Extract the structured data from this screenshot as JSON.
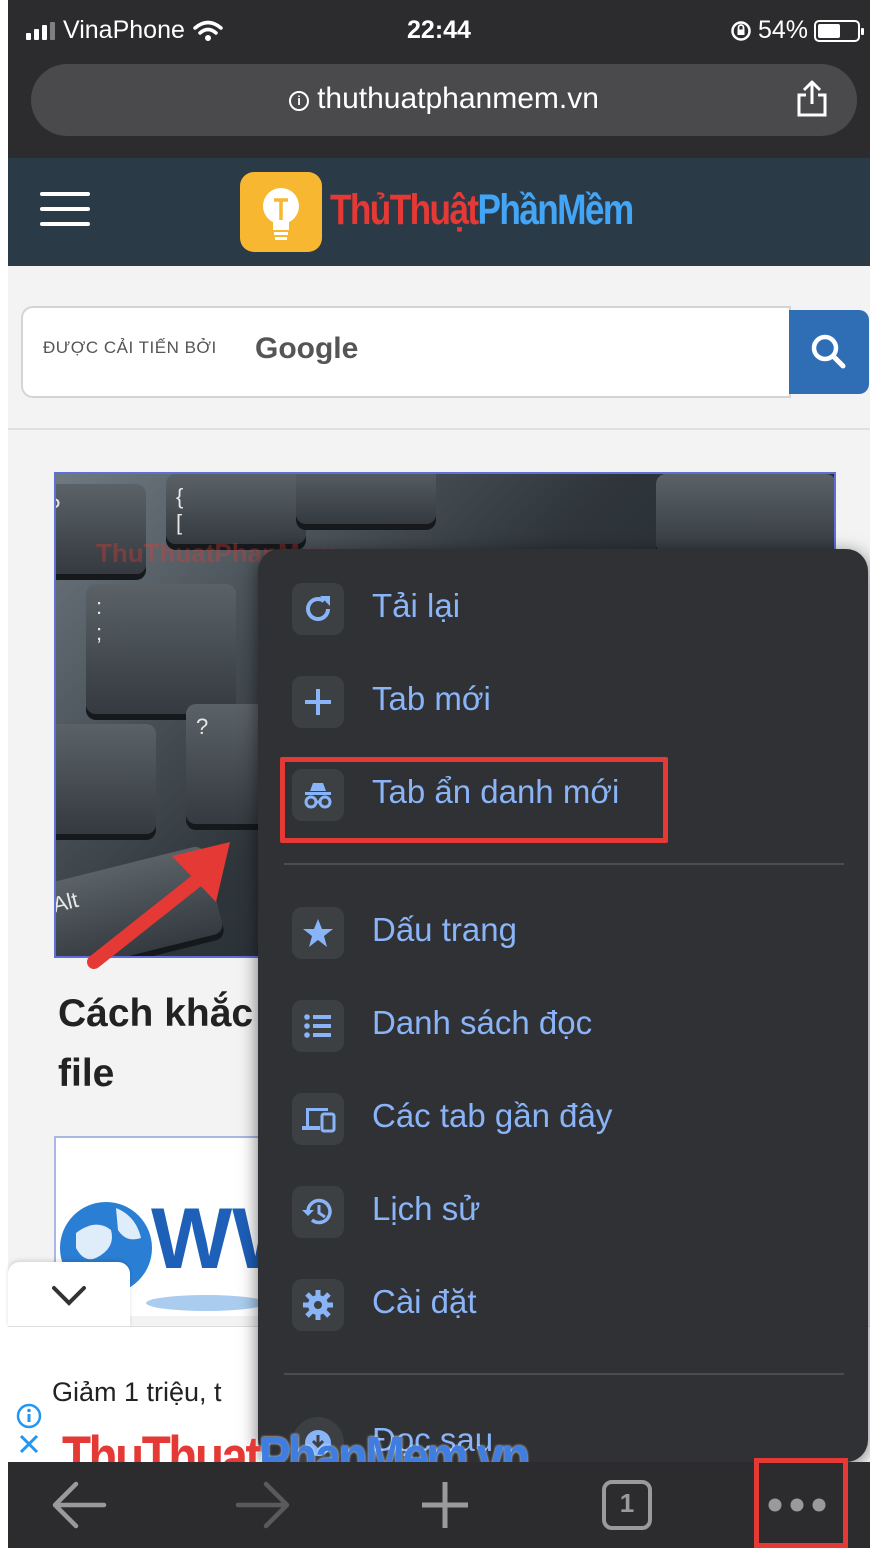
{
  "status_bar": {
    "carrier": "VinaPhone",
    "time": "22:44",
    "battery": "54%"
  },
  "address_bar": {
    "url": "thuthuatphanmem.vn"
  },
  "site": {
    "logo_part1": "ThủThuật",
    "logo_part2": "PhầnMềm",
    "search_powered": "ĐƯỢC CẢI TIẾN BỞI",
    "search_brand": "Google"
  },
  "article": {
    "title_line1": "Cách khắc",
    "title_line2": "file",
    "image_watermark": "ThuThuatPhanMem"
  },
  "ad": {
    "text": "Giảm 1 triệu, t"
  },
  "menu": {
    "items": [
      {
        "label": "Tải lại",
        "icon": "reload-icon"
      },
      {
        "label": "Tab mới",
        "icon": "plus-icon"
      },
      {
        "label": "Tab ẩn danh mới",
        "icon": "incognito-icon"
      },
      {
        "label": "Dấu trang",
        "icon": "star-icon"
      },
      {
        "label": "Danh sách đọc",
        "icon": "list-icon"
      },
      {
        "label": "Các tab gần đây",
        "icon": "devices-icon"
      },
      {
        "label": "Lịch sử",
        "icon": "history-icon"
      },
      {
        "label": "Cài đặt",
        "icon": "gear-icon"
      },
      {
        "label": "Đọc sau",
        "icon": "read-later-icon"
      }
    ]
  },
  "toolbar": {
    "tab_count": "1"
  },
  "watermark": {
    "part1": "ThuThuat",
    "part2": "PhanMem.vn"
  },
  "colors": {
    "menu_bg": "#303134",
    "menu_text": "#8ab4f8",
    "highlight": "#e53935",
    "header_bg": "#2b3a47"
  }
}
